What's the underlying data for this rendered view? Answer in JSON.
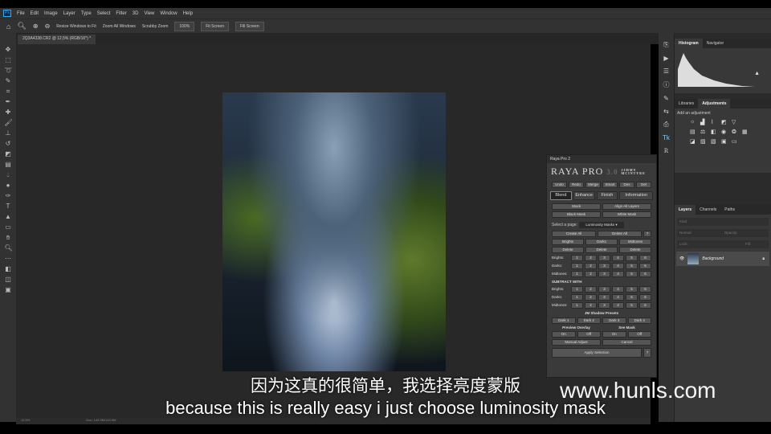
{
  "menu": [
    "File",
    "Edit",
    "Image",
    "Layer",
    "Type",
    "Select",
    "Filter",
    "3D",
    "View",
    "Window",
    "Help"
  ],
  "options": {
    "resize": "Resize Windows to Fit",
    "zoom_all": "Zoom All Windows",
    "scrubby": "Scrubby Zoom",
    "zoom_value": "100%",
    "fit": "Fit Screen",
    "fill": "Fill Screen"
  },
  "document_tab": "2Q3A4338.CR2 @ 12,5% (RGB/16*) *",
  "status": {
    "zoom": "12.5%",
    "doc": "Doc: 143.9M/143.9M"
  },
  "panels": {
    "histogram": "Histogram",
    "navigator": "Navigator",
    "libraries": "Libraries",
    "adjustments": "Adjustments",
    "add_adjustment": "Add an adjustment",
    "layers": "Layers",
    "channels": "Channels",
    "paths": "Paths",
    "kind": "Kind",
    "normal": "Normal",
    "opacity": "Opacity:",
    "lock": "Lock:",
    "fill": "Fill:",
    "layer_name": "Background"
  },
  "raya": {
    "title": "Raya Pro 2",
    "logo": "RAYA PRO",
    "version": "3.0",
    "author1": "JIMMY",
    "author2": "MCINTYRE",
    "top": [
      "Undo",
      "Redo",
      "Merge",
      "Smart",
      "Des",
      "Del"
    ],
    "tabs": [
      "Blend",
      "Enhance",
      "Finish",
      "Information"
    ],
    "stack": "Stack",
    "align": "Align All Layers",
    "black": "Black Mask",
    "white": "White Mask",
    "select_page": "Select a page:",
    "page": "Luminosity Masks ▾",
    "create_all": "Create All",
    "delete_all": "Delete All",
    "help": "?",
    "brights": "Brights",
    "darks": "Darks",
    "midtones": "Midtones",
    "delete": "Delete",
    "rows": [
      "Brights:",
      "Darks:",
      "Midtones:"
    ],
    "nums": [
      "1",
      "2",
      "3",
      "4",
      "5",
      "6"
    ],
    "subtract": "SUBTRACT WITH",
    "presets_title": "JM Shadow Presets",
    "presets": [
      "Dark 1",
      "Dark 2",
      "Dark 3",
      "Dark 4"
    ],
    "preview": "Preview Overlay",
    "see_mask": "See Mask",
    "on": "On",
    "off": "Off",
    "manual": "Manual Adjust",
    "cancel": "Cancel",
    "apply": "Apply Selection"
  },
  "subtitle_cn": "因为这真的很简单，我选择亮度蒙版",
  "subtitle_en": "because this is really easy i just choose luminosity mask",
  "watermark": "www.hunls.com"
}
